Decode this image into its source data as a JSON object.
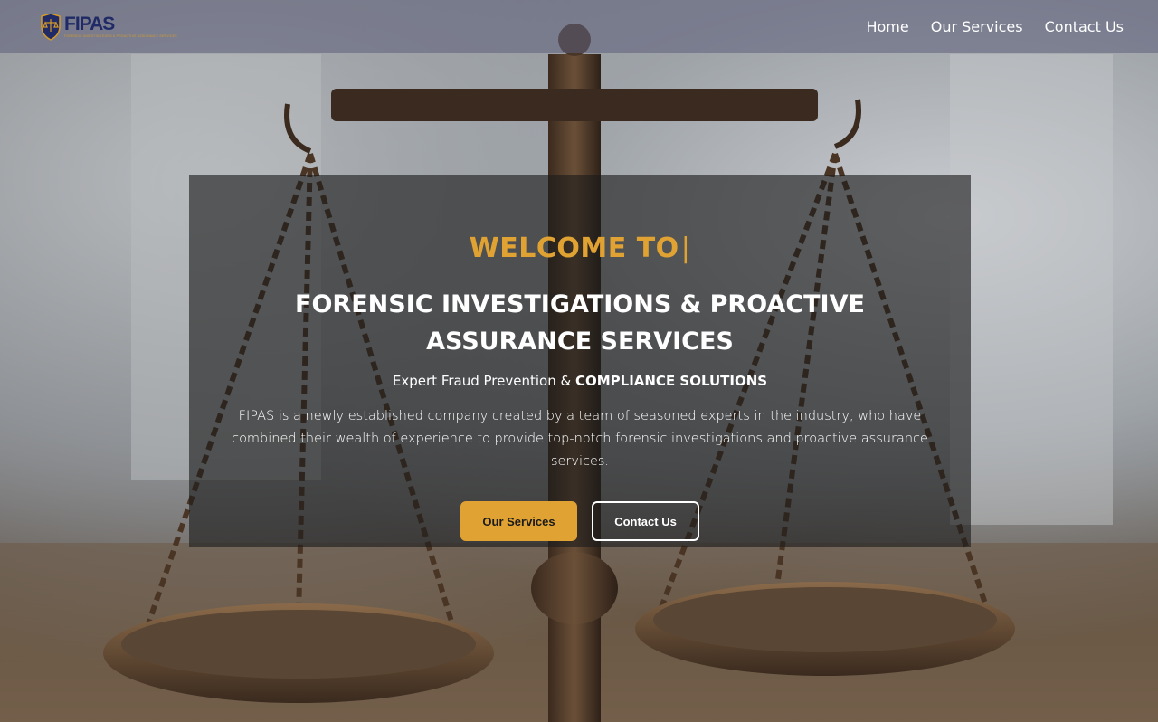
{
  "nav": {
    "logo_text": "FIPAS",
    "logo_tagline": "FORENSIC INVESTIGATIONS & PROACTIVE ASSURANCE SERVICES",
    "items": [
      {
        "label": "Home"
      },
      {
        "label": "Our Services"
      },
      {
        "label": "Contact Us"
      }
    ]
  },
  "hero": {
    "welcome": "WELCOME TO",
    "cursor": "|",
    "title": "FORENSIC INVESTIGATIONS & PROACTIVE ASSURANCE SERVICES",
    "subtitle_plain": "Expert Fraud Prevention & ",
    "subtitle_bold": "COMPLIANCE SOLUTIONS",
    "description": "FIPAS is a newly established company created by a team of seasoned experts in the industry, who have combined their wealth of experience to provide top-notch forensic investigations and proactive assurance services.",
    "primary_button": "Our Services",
    "secondary_button": "Contact Us"
  },
  "colors": {
    "accent": "#e0a232",
    "brand_navy": "#1f2a66",
    "navbar_bg": "#5c5f7a",
    "text": "#ffffff"
  },
  "icons": {
    "logo_emblem": "shield-scales-icon",
    "background": "scales-of-justice-photo"
  }
}
